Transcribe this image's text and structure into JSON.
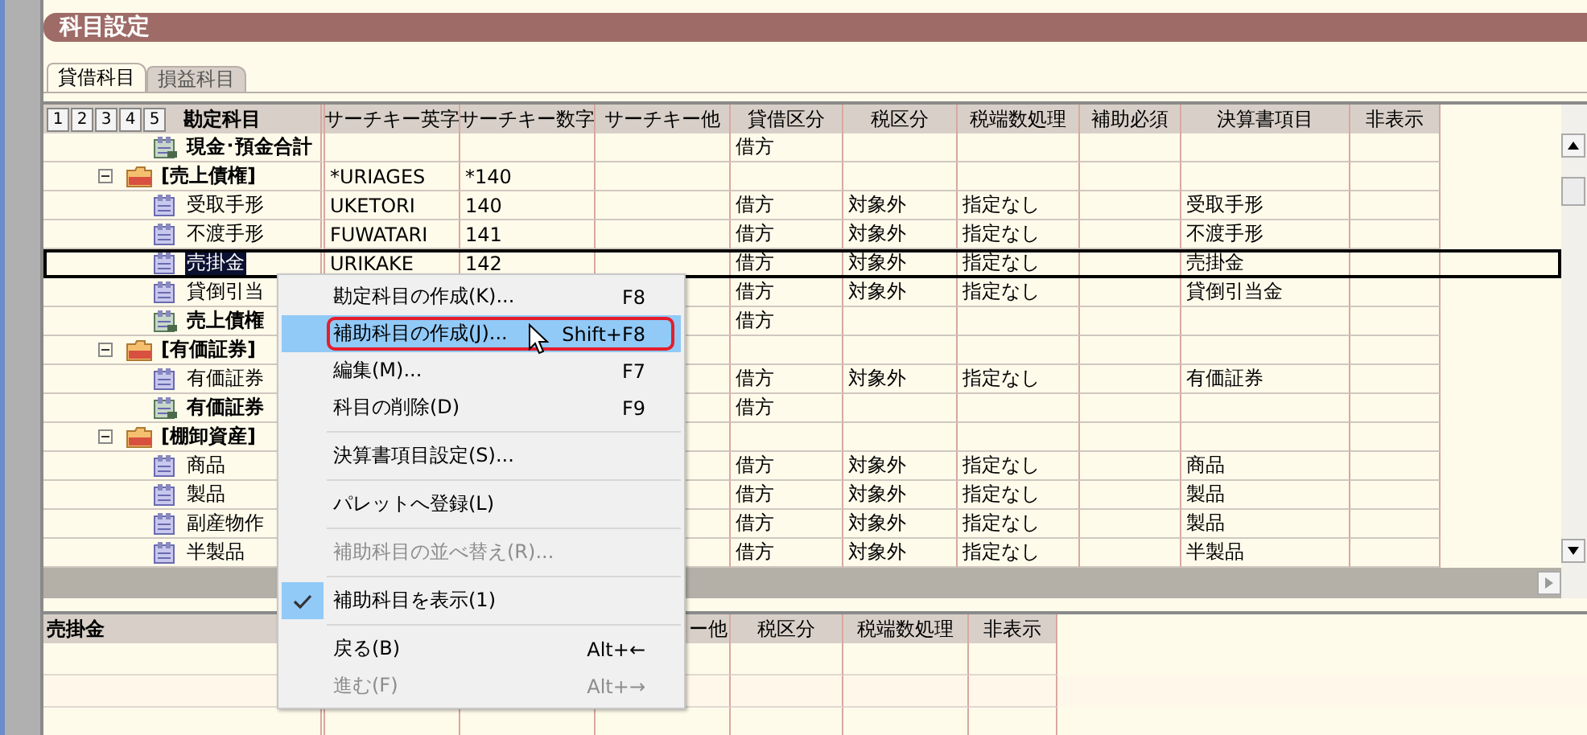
{
  "window": {
    "title": "科目設定"
  },
  "tabs": [
    {
      "label": "貸借科目",
      "selected": true
    },
    {
      "label": "損益科目",
      "selected": false
    }
  ],
  "grid": {
    "level_buttons": [
      "1",
      "2",
      "3",
      "4",
      "5"
    ],
    "columns": [
      "勘定科目",
      "サーチキー英字",
      "サーチキー数字",
      "サーチキー他",
      "貸借区分",
      "税区分",
      "税端数処理",
      "補助必須",
      "決算書項目",
      "非表示"
    ],
    "rows": [
      {
        "name": "現金･預金合計",
        "kind": "total",
        "selected": false,
        "debit_credit": "借方"
      },
      {
        "name": "[売上債権]",
        "kind": "group",
        "expanded": true,
        "selected": false,
        "search_en": "*URIAGES",
        "search_num": "*140",
        "children": [
          {
            "name": "受取手形",
            "kind": "account",
            "selected": false,
            "search_en": "UKETORI",
            "search_num": "140",
            "debit_credit": "借方",
            "tax": "対象外",
            "tax_rounding": "指定なし",
            "report_item": "受取手形"
          },
          {
            "name": "不渡手形",
            "kind": "account",
            "selected": false,
            "search_en": "FUWATARI",
            "search_num": "141",
            "debit_credit": "借方",
            "tax": "対象外",
            "tax_rounding": "指定なし",
            "report_item": "不渡手形"
          },
          {
            "name": "売掛金",
            "kind": "account",
            "selected": true,
            "search_en": "URIKAKE",
            "search_num": "142",
            "debit_credit": "借方",
            "tax": "対象外",
            "tax_rounding": "指定なし",
            "report_item": "売掛金"
          },
          {
            "name": "貸倒引当",
            "kind": "account",
            "selected": false,
            "debit_credit": "借方",
            "tax": "対象外",
            "tax_rounding": "指定なし",
            "report_item": "貸倒引当金"
          },
          {
            "name": "売上債権",
            "kind": "total",
            "selected": false,
            "debit_credit": "借方"
          }
        ]
      },
      {
        "name": "[有価証券]",
        "kind": "group",
        "expanded": true,
        "selected": false,
        "children": [
          {
            "name": "有価証券",
            "kind": "account",
            "selected": false,
            "debit_credit": "借方",
            "tax": "対象外",
            "tax_rounding": "指定なし",
            "report_item": "有価証券"
          },
          {
            "name": "有価証券",
            "kind": "total",
            "selected": false,
            "debit_credit": "借方"
          }
        ]
      },
      {
        "name": "[棚卸資産]",
        "kind": "group",
        "expanded": true,
        "selected": false,
        "children": [
          {
            "name": "商品",
            "kind": "account",
            "selected": false,
            "debit_credit": "借方",
            "tax": "対象外",
            "tax_rounding": "指定なし",
            "report_item": "商品"
          },
          {
            "name": "製品",
            "kind": "account",
            "selected": false,
            "debit_credit": "借方",
            "tax": "対象外",
            "tax_rounding": "指定なし",
            "report_item": "製品"
          },
          {
            "name": "副産物作",
            "kind": "account",
            "selected": false,
            "debit_credit": "借方",
            "tax": "対象外",
            "tax_rounding": "指定なし",
            "report_item": "製品"
          },
          {
            "name": "半製品",
            "kind": "account",
            "selected": false,
            "debit_credit": "借方",
            "tax": "対象外",
            "tax_rounding": "指定なし",
            "report_item": "半製品"
          }
        ]
      }
    ]
  },
  "detail": {
    "title": "売掛金",
    "columns": [
      "ー他",
      "税区分",
      "税端数処理",
      "非表示"
    ]
  },
  "context_menu": [
    {
      "kind": "item",
      "label": "勘定科目の作成(K)...",
      "shortcut": "F8",
      "disabled": false,
      "highlighted": false,
      "checked": false
    },
    {
      "kind": "item",
      "label": "補助科目の作成(J)...",
      "shortcut": "Shift+F8",
      "disabled": false,
      "highlighted": true,
      "checked": false
    },
    {
      "kind": "item",
      "label": "編集(M)...",
      "shortcut": "F7",
      "disabled": false,
      "highlighted": false,
      "checked": false
    },
    {
      "kind": "item",
      "label": "科目の削除(D)",
      "shortcut": "F9",
      "disabled": false,
      "highlighted": false,
      "checked": false
    },
    {
      "kind": "separator"
    },
    {
      "kind": "item",
      "label": "決算書項目設定(S)...",
      "disabled": false,
      "highlighted": false,
      "checked": false
    },
    {
      "kind": "separator"
    },
    {
      "kind": "item",
      "label": "パレットへ登録(L)",
      "disabled": false,
      "highlighted": false,
      "checked": false
    },
    {
      "kind": "separator"
    },
    {
      "kind": "item",
      "label": "補助科目の並べ替え(R)...",
      "disabled": true,
      "highlighted": false,
      "checked": false
    },
    {
      "kind": "separator"
    },
    {
      "kind": "item",
      "label": "補助科目を表示(1)",
      "disabled": false,
      "highlighted": false,
      "checked": true
    },
    {
      "kind": "separator"
    },
    {
      "kind": "item",
      "label": "戻る(B)",
      "shortcut": "Alt+←",
      "disabled": false,
      "highlighted": false,
      "checked": false
    },
    {
      "kind": "item",
      "label": "進む(F)",
      "shortcut": "Alt+→",
      "disabled": true,
      "highlighted": false,
      "checked": false
    }
  ]
}
